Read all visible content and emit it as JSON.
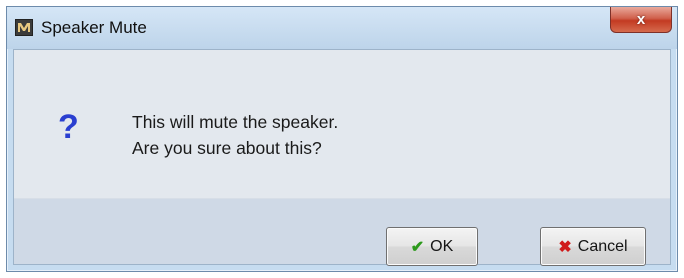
{
  "window": {
    "title": "Speaker Mute",
    "close_label": "x"
  },
  "message": {
    "line1": "This will mute the speaker.",
    "line2": "Are you sure about this?",
    "icon_glyph": "?"
  },
  "buttons": {
    "ok_label": "OK",
    "ok_icon": "✔",
    "cancel_label": "Cancel",
    "cancel_icon": "✖"
  },
  "icons": {
    "app": "app-logo-icon",
    "question": "question-icon",
    "ok": "checkmark-icon",
    "cancel": "cross-icon"
  },
  "colors": {
    "question_icon": "#2a3fd0",
    "ok_glyph": "#2d9a1c",
    "cancel_glyph": "#d01a1a",
    "close_button": "#c33a22"
  }
}
